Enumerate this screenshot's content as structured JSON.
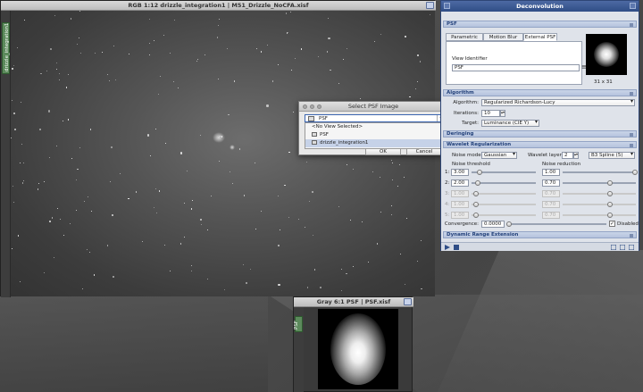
{
  "image_window": {
    "title": "RGB 1:12 drizzle_integration1 | M51_Drizzle_NoCFA.xisf",
    "side_tab": "drizzle_integration1"
  },
  "select_psf_dialog": {
    "title": "Select PSF Image",
    "selected": "PSF",
    "options": [
      "<No View Selected>",
      "PSF",
      "drizzle_integration1"
    ],
    "ok_label": "OK",
    "cancel_label": "Cancel"
  },
  "psf_window": {
    "title": "Gray 6:1 PSF | PSF.xisf",
    "side_tab": "PSF"
  },
  "deconvolution": {
    "title": "Deconvolution",
    "psf_section": "PSF",
    "tabs": [
      "Parametric PSF",
      "Motion Blur PSF",
      "External PSF"
    ],
    "view_identifier_label": "View Identifier",
    "view_identifier_value": "PSF",
    "psf_size": "31 x 31",
    "algorithm_section": "Algorithm",
    "algorithm_label": "Algorithm:",
    "algorithm_value": "Regularized Richardson-Lucy",
    "iterations_label": "Iterations:",
    "iterations_value": "10",
    "target_label": "Target:",
    "target_value": "Luminance (CIE Y)",
    "deringing_section": "Deringing",
    "wavelet_section": "Wavelet Regularization",
    "noise_model_label": "Noise model:",
    "noise_model_value": "Gaussian",
    "wavelet_layers_label": "Wavelet layers:",
    "wavelet_layers_value": "2",
    "scaling_value": "B3 Spline (5)",
    "noise_threshold_label": "Noise threshold",
    "noise_reduction_label": "Noise reduction",
    "layers": [
      {
        "label": "1:",
        "threshold": "3.00",
        "reduction": "1.00"
      },
      {
        "label": "2:",
        "threshold": "2.00",
        "reduction": "0.70"
      },
      {
        "label": "3:",
        "threshold": "1.00",
        "reduction": "0.70"
      },
      {
        "label": "4:",
        "threshold": "1.00",
        "reduction": "0.70"
      },
      {
        "label": "5:",
        "threshold": "1.00",
        "reduction": "0.70"
      }
    ],
    "convergence_label": "Convergence:",
    "convergence_value": "0.0000",
    "disabled_label": "Disabled",
    "dynamic_range_section": "Dynamic Range Extension",
    "accent_color": "#2f4d86"
  }
}
